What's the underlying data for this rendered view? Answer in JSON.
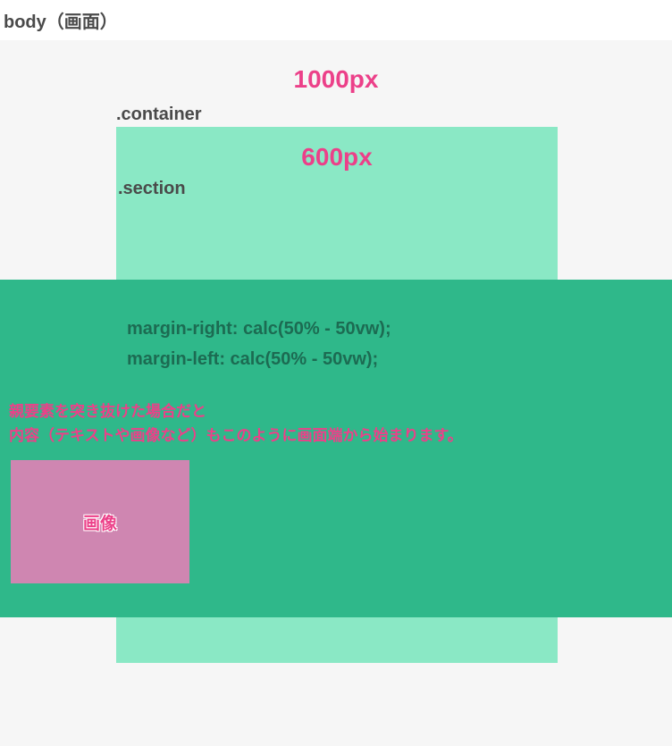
{
  "bodyLabel": "body（画面）",
  "width1000": "1000px",
  "containerLabel": ".container",
  "width600": "600px",
  "sectionLabel": ".section",
  "codeLine1": "margin-right: calc(50% - 50vw);",
  "codeLine2": "margin-left: calc(50% - 50vw);",
  "noteLine1": "親要素を突き抜けた場合だと",
  "noteLine2": "内容（テキストや画像など）もこのように画面端から始まります。",
  "imageLabel": "画像"
}
